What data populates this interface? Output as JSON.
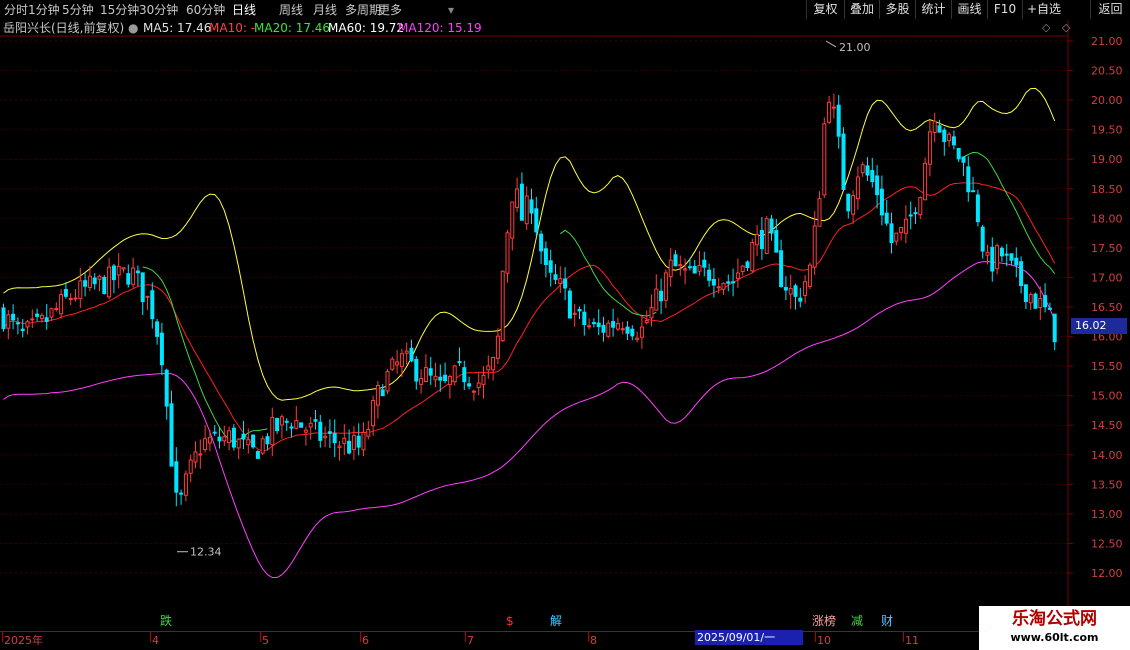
{
  "toolbar": {
    "periods": [
      "分时",
      "1分钟",
      "5分钟",
      "15分钟",
      "30分钟",
      "60分钟",
      "日线",
      "周线",
      "月线",
      "多周期",
      "更多"
    ],
    "active_period": "日线",
    "right_buttons": [
      "复权",
      "叠加",
      "多股",
      "统计",
      "画线",
      "F10",
      "+自选",
      "返回"
    ]
  },
  "title": {
    "stock": "岳阳兴长(日线,前复权)",
    "ma5": "MA5: 17.46",
    "ma10": "MA10: -",
    "ma20": "MA20: 17.46",
    "ma60": "MA60: 19.72",
    "ma120": "MA120: 15.19"
  },
  "colors": {
    "up": "#ff3c3c",
    "down": "#00e5ff",
    "ma5": "#e8e8e8",
    "ma10": "#ffff40",
    "ma20": "#ff2020",
    "ma60": "#40d840",
    "ma120": "#ff40ff",
    "grid": "#7a0000"
  },
  "price_axis": [
    "21.00",
    "20.50",
    "20.00",
    "19.50",
    "19.00",
    "18.50",
    "18.00",
    "17.50",
    "17.00",
    "16.50",
    "16.02",
    "16.00",
    "15.50",
    "15.00",
    "14.50",
    "14.00",
    "13.50",
    "13.00",
    "12.50",
    "12.00"
  ],
  "current_price": "16.02",
  "annotations": {
    "high": "21.00",
    "low": "12.34"
  },
  "events": [
    {
      "text": "跌",
      "color": "#40d840"
    },
    {
      "text": "$",
      "color": "#ff3030"
    },
    {
      "text": "解",
      "color": "#40d0ff"
    },
    {
      "text": "涨榜",
      "color": "#ffa0a0"
    },
    {
      "text": "减",
      "color": "#40d840"
    },
    {
      "text": "财",
      "color": "#60c0ff"
    }
  ],
  "time_axis": [
    "2025年",
    "4",
    "5",
    "6",
    "7",
    "8",
    "9",
    "10",
    "11"
  ],
  "selected_date": "2025/09/01/一",
  "watermark": {
    "line1": "乐淘公式网",
    "line2": "www.60lt.com"
  },
  "icons": [
    "diamond-icon",
    "chevron-icon"
  ],
  "chart_data": {
    "type": "candlestick",
    "title": "岳阳兴长(日线,前复权)",
    "ylim": [
      11.8,
      21.2
    ],
    "high_label": 21.0,
    "low_label": 12.34,
    "last_close": 16.02,
    "series": [
      {
        "name": "MA5",
        "values": [
          17.46
        ]
      },
      {
        "name": "MA20",
        "values": [
          17.46
        ]
      },
      {
        "name": "MA60",
        "values": [
          19.72
        ]
      },
      {
        "name": "MA120",
        "values": [
          15.19
        ]
      }
    ],
    "ohlc_key_points": [
      {
        "period": "2025-03",
        "close": 16.2
      },
      {
        "period": "2025-04",
        "low": 12.34
      },
      {
        "period": "2025-06",
        "close": 14.2
      },
      {
        "period": "2025-07",
        "high": 19.0
      },
      {
        "period": "2025-09",
        "high": 21.0
      },
      {
        "period": "2025-10",
        "close": 19.8
      },
      {
        "period": "2025-11",
        "close": 16.02
      }
    ]
  }
}
